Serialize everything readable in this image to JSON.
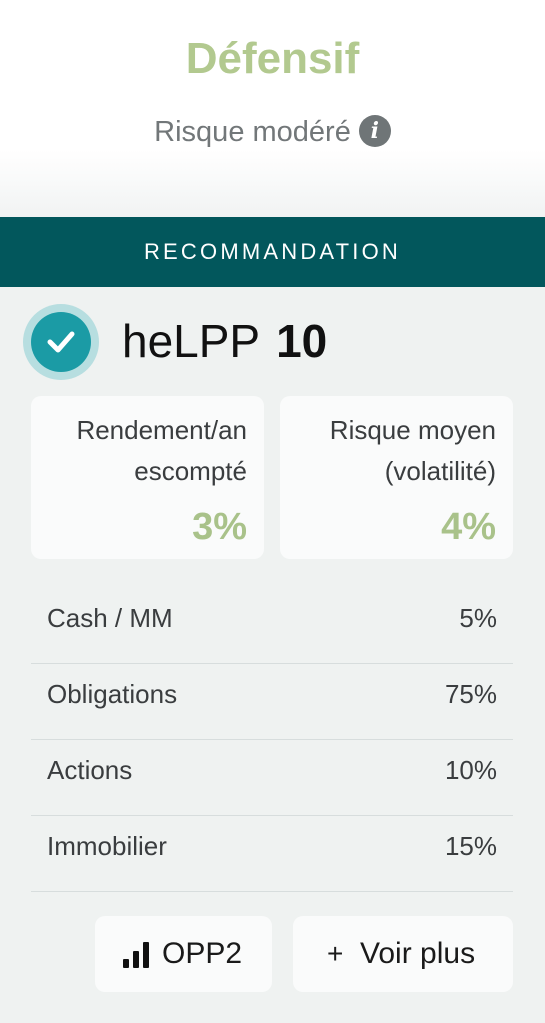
{
  "profile": {
    "title": "Défensif",
    "risk_level": "Risque modéré",
    "info_icon": "info-icon"
  },
  "recommendation": {
    "header": "RECOMMANDATION",
    "product": {
      "name": "heLPP",
      "number": "10",
      "selected": true
    },
    "stats": [
      {
        "label_line1": "Rendement/an",
        "label_line2": "escompté",
        "value": "3%"
      },
      {
        "label_line1": "Risque moyen",
        "label_line2": "(volatilité)",
        "value": "4%"
      }
    ],
    "allocation": [
      {
        "name": "Cash / MM",
        "value": "5%"
      },
      {
        "name": "Obligations",
        "value": "75%"
      },
      {
        "name": "Actions",
        "value": "10%"
      },
      {
        "name": "Immobilier",
        "value": "15%"
      }
    ],
    "buttons": {
      "opp2": {
        "label": "OPP2",
        "icon": "bar-chart-icon"
      },
      "more": {
        "label": "Voir plus",
        "icon": "plus-icon"
      }
    }
  },
  "colors": {
    "accent_green": "#b2c98f",
    "header_teal": "#02575c",
    "check_teal": "#1b9ba5",
    "card_bg": "#eff2f1"
  }
}
